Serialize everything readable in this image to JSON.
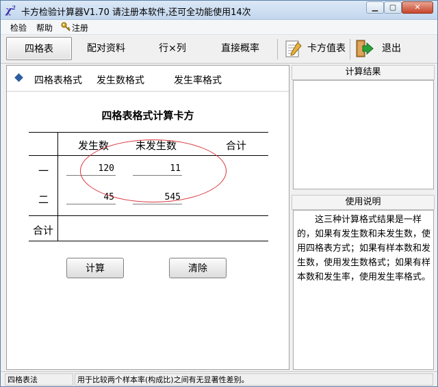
{
  "window": {
    "title": "卡方检验计算器V1.70    请注册本软件,还可全功能使用14次",
    "app_icon": "χ",
    "app_icon_sup": "2",
    "min_symbol": "▁",
    "max_symbol": "▢",
    "close_symbol": "✕"
  },
  "menu": {
    "items": [
      "检验",
      "帮助",
      "注册"
    ]
  },
  "toolbar": {
    "buttons": [
      "四格表",
      "配对资料",
      "行×列",
      "直接概率",
      "卡方值表",
      "退出"
    ]
  },
  "format_tabs": [
    "四格表格式",
    "发生数格式",
    "发生率格式"
  ],
  "sheet": {
    "title": "四格表格式计算卡方",
    "col_headers": [
      "发生数",
      "未发生数",
      "合计"
    ],
    "row_headers": [
      "一",
      "二",
      "合计"
    ],
    "values": {
      "r1c1": "120",
      "r1c2": "11",
      "r2c1": "45",
      "r2c2": "545"
    }
  },
  "buttons": {
    "calc": "计算",
    "clear": "清除"
  },
  "results": {
    "header": "计算结果",
    "content": ""
  },
  "help": {
    "header": "使用说明",
    "text": "这三种计算格式结果是一样的，如果有发生数和未发生数，使用四格表方式；如果有样本数和发生数，使用发生数格式；如果有样本数和发生率，使用发生率格式。"
  },
  "status": {
    "mode": "四格表法",
    "description": "用于比较两个样本率(构成比)之间有无显著性差别。"
  },
  "colors": {
    "accent": "#2e5d9f",
    "ellipse": "#d9333a",
    "exit_arrow": "#2aa13a"
  }
}
